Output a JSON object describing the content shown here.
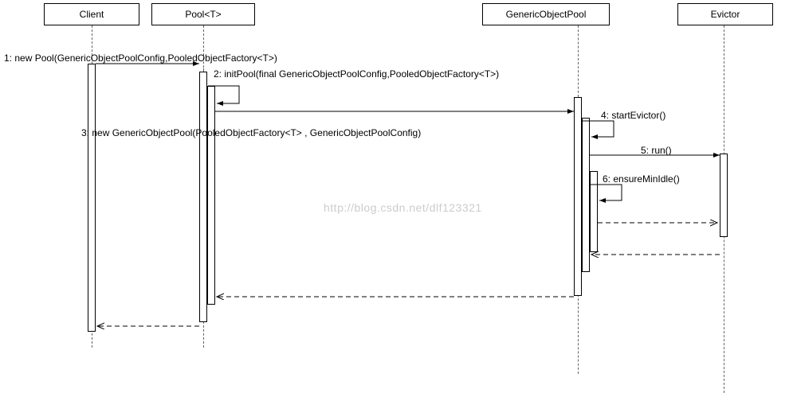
{
  "participants": {
    "client": "Client",
    "pool": "Pool<T>",
    "gop": "GenericObjectPool",
    "evictor": "Evictor"
  },
  "messages": {
    "m1": "1: new Pool(GenericObjectPoolConfig,PooledObjectFactory<T>)",
    "m2": "2: initPool(final GenericObjectPoolConfig,PooledObjectFactory<T>)",
    "m3": "3: new GenericObjectPool(PooledObjectFactory<T> ,  GenericObjectPoolConfig)",
    "m4": "4: startEvictor()",
    "m5": "5: run()",
    "m6": "6: ensureMinIdle()"
  },
  "watermark": "http://blog.csdn.net/dlf123321"
}
